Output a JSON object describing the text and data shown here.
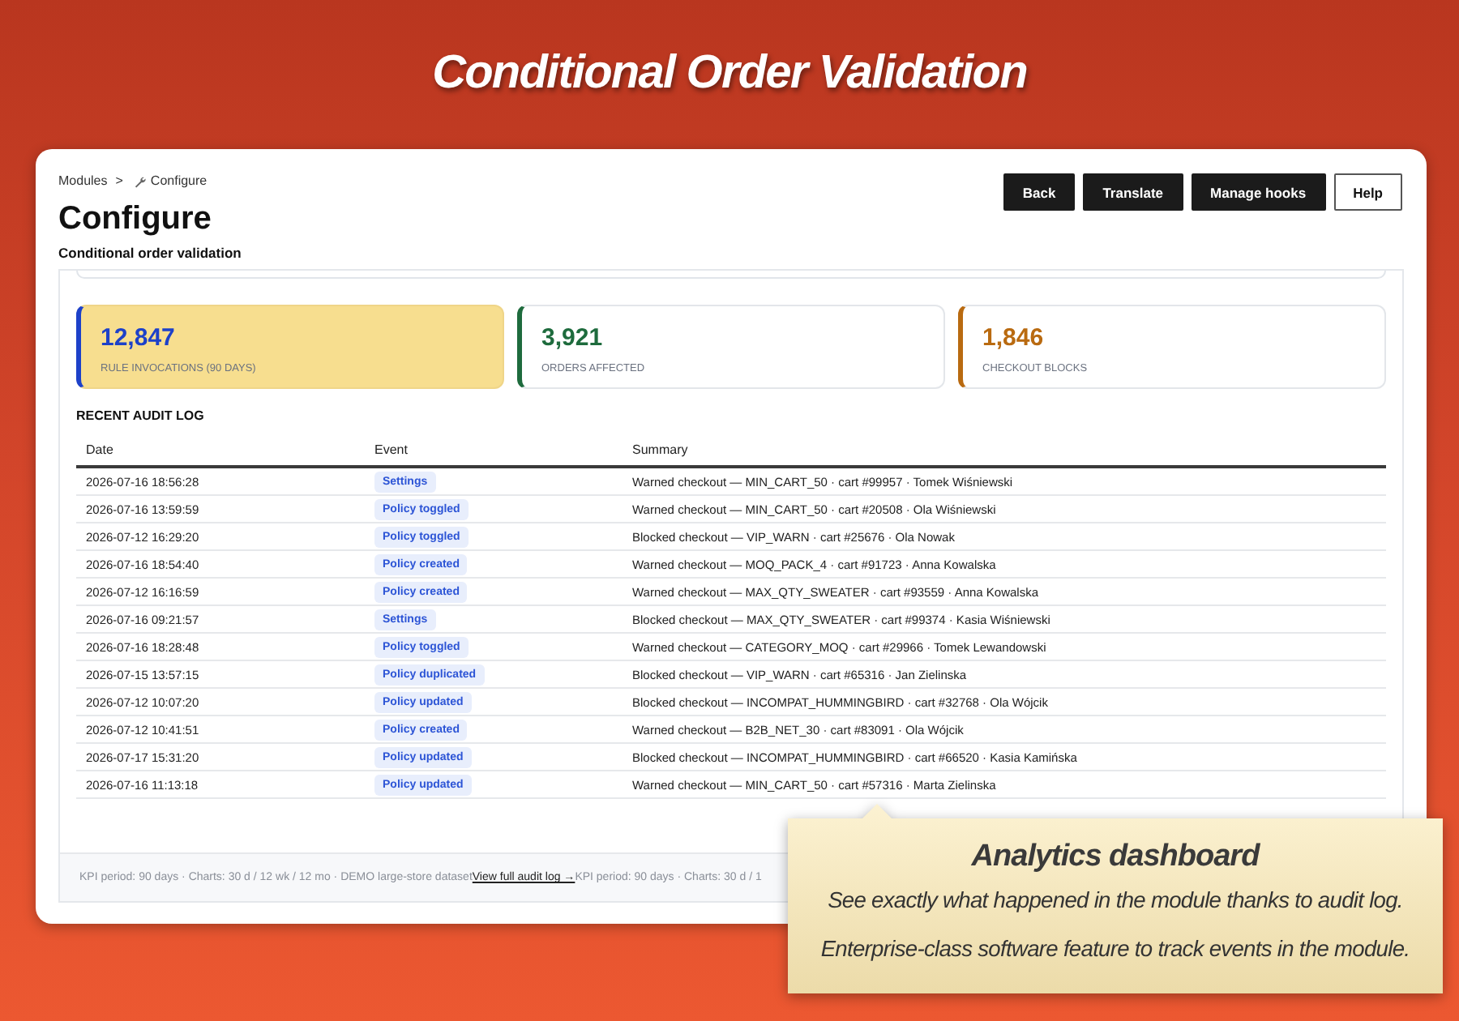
{
  "banner": {
    "title": "Conditional Order Validation"
  },
  "header": {
    "breadcrumb": {
      "items": [
        {
          "label": "Modules",
          "kind": "link"
        },
        {
          "label": "Configure",
          "kind": "current"
        }
      ],
      "separator": ">"
    },
    "title": "Configure",
    "subtitle": "Conditional order validation",
    "actions": [
      {
        "label": "Back",
        "kind": "primary"
      },
      {
        "label": "Translate",
        "kind": "primary"
      },
      {
        "label": "Manage hooks",
        "kind": "primary"
      },
      {
        "label": "Help",
        "kind": "outline"
      }
    ]
  },
  "kpis": [
    {
      "value": "12,847",
      "label": "RULE INVOCATIONS (90 DAYS)",
      "color": "#1d41c9",
      "selected": true
    },
    {
      "value": "3,921",
      "label": "ORDERS AFFECTED",
      "color": "#1e6b3d",
      "selected": false
    },
    {
      "value": "1,846",
      "label": "CHECKOUT BLOCKS",
      "color": "#b96a10",
      "selected": false
    }
  ],
  "audit_log": {
    "title": "RECENT AUDIT LOG",
    "columns": [
      "Date",
      "Event",
      "Summary"
    ],
    "rows": [
      {
        "date": "2026-07-16 18:56:28",
        "event": "Settings",
        "summary": "Warned checkout — MIN_CART_50 · cart #99957 · Tomek Wiśniewski"
      },
      {
        "date": "2026-07-16 13:59:59",
        "event": "Policy toggled",
        "summary": "Warned checkout — MIN_CART_50 · cart #20508 · Ola Wiśniewski"
      },
      {
        "date": "2026-07-12 16:29:20",
        "event": "Policy toggled",
        "summary": "Blocked checkout — VIP_WARN · cart #25676 · Ola Nowak"
      },
      {
        "date": "2026-07-16 18:54:40",
        "event": "Policy created",
        "summary": "Warned checkout — MOQ_PACK_4 · cart #91723 · Anna Kowalska"
      },
      {
        "date": "2026-07-12 16:16:59",
        "event": "Policy created",
        "summary": "Warned checkout — MAX_QTY_SWEATER · cart #93559 · Anna Kowalska"
      },
      {
        "date": "2026-07-16 09:21:57",
        "event": "Settings",
        "summary": "Blocked checkout — MAX_QTY_SWEATER · cart #99374 · Kasia Wiśniewski"
      },
      {
        "date": "2026-07-16 18:28:48",
        "event": "Policy toggled",
        "summary": "Warned checkout — CATEGORY_MOQ · cart #29966 · Tomek Lewandowski"
      },
      {
        "date": "2026-07-15 13:57:15",
        "event": "Policy duplicated",
        "summary": "Blocked checkout — VIP_WARN · cart #65316 · Jan Zielinska"
      },
      {
        "date": "2026-07-12 10:07:20",
        "event": "Policy updated",
        "summary": "Blocked checkout — INCOMPAT_HUMMINGBIRD · cart #32768 · Ola Wójcik"
      },
      {
        "date": "2026-07-12 10:41:51",
        "event": "Policy created",
        "summary": "Warned checkout — B2B_NET_30 · cart #83091 · Ola Wójcik"
      },
      {
        "date": "2026-07-17 15:31:20",
        "event": "Policy updated",
        "summary": "Blocked checkout — INCOMPAT_HUMMINGBIRD · cart #66520 · Kasia Kamińska"
      },
      {
        "date": "2026-07-16 11:13:18",
        "event": "Policy updated",
        "summary": "Warned checkout — MIN_CART_50 · cart #57316 · Marta Zielinska"
      }
    ]
  },
  "footer": {
    "note": "KPI period: 90 days · Charts: 30 d / 12 wk / 12 mo · DEMO large-store dataset",
    "link": "View full audit log →",
    "note_repeat": "KPI period: 90 days · Charts: 30 d / 1"
  },
  "callout": {
    "title": "Analytics dashboard",
    "lines": [
      "See exactly what happened in the module thanks to audit log.",
      "Enterprise-class software feature to track events in the module."
    ]
  }
}
